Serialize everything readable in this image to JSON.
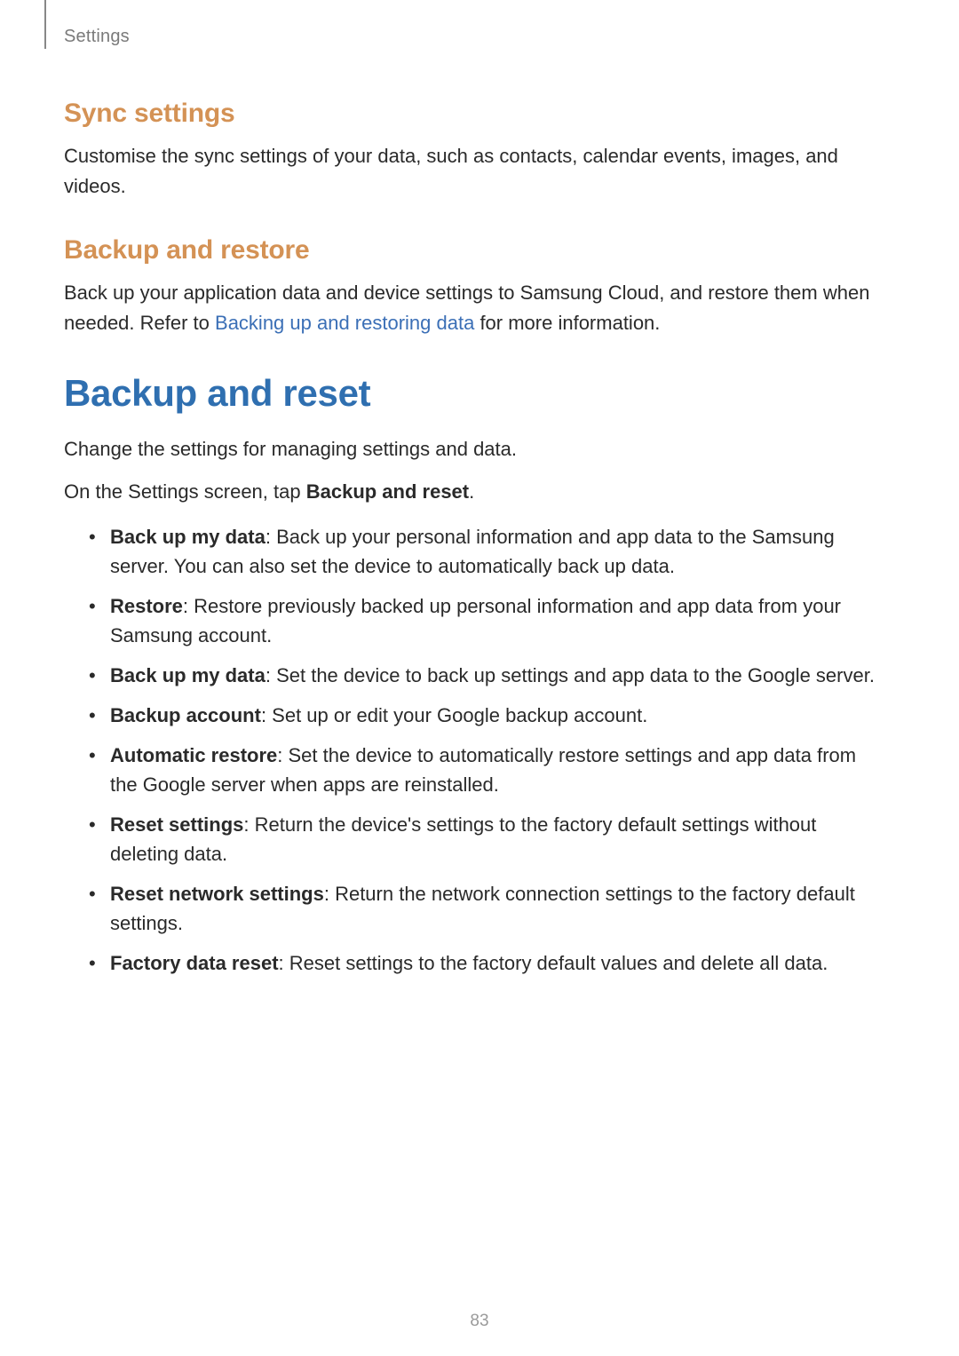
{
  "header": {
    "breadcrumb": "Settings"
  },
  "sections": {
    "sync": {
      "title": "Sync settings",
      "body": "Customise the sync settings of your data, such as contacts, calendar events, images, and videos."
    },
    "backup_restore": {
      "title": "Backup and restore",
      "body_pre": "Back up your application data and device settings to Samsung Cloud, and restore them when needed. Refer to ",
      "link": "Backing up and restoring data",
      "body_post": " for more information."
    },
    "backup_reset": {
      "title": "Backup and reset",
      "intro": "Change the settings for managing settings and data.",
      "tap_pre": "On the Settings screen, tap ",
      "tap_bold": "Backup and reset",
      "tap_post": ".",
      "items": [
        {
          "label": "Back up my data",
          "desc": ": Back up your personal information and app data to the Samsung server. You can also set the device to automatically back up data."
        },
        {
          "label": "Restore",
          "desc": ": Restore previously backed up personal information and app data from your Samsung account."
        },
        {
          "label": "Back up my data",
          "desc": ": Set the device to back up settings and app data to the Google server."
        },
        {
          "label": "Backup account",
          "desc": ": Set up or edit your Google backup account."
        },
        {
          "label": "Automatic restore",
          "desc": ": Set the device to automatically restore settings and app data from the Google server when apps are reinstalled."
        },
        {
          "label": "Reset settings",
          "desc": ": Return the device's settings to the factory default settings without deleting data."
        },
        {
          "label": "Reset network settings",
          "desc": ": Return the network connection settings to the factory default settings."
        },
        {
          "label": "Factory data reset",
          "desc": ": Reset settings to the factory default values and delete all data."
        }
      ]
    }
  },
  "page_number": "83"
}
